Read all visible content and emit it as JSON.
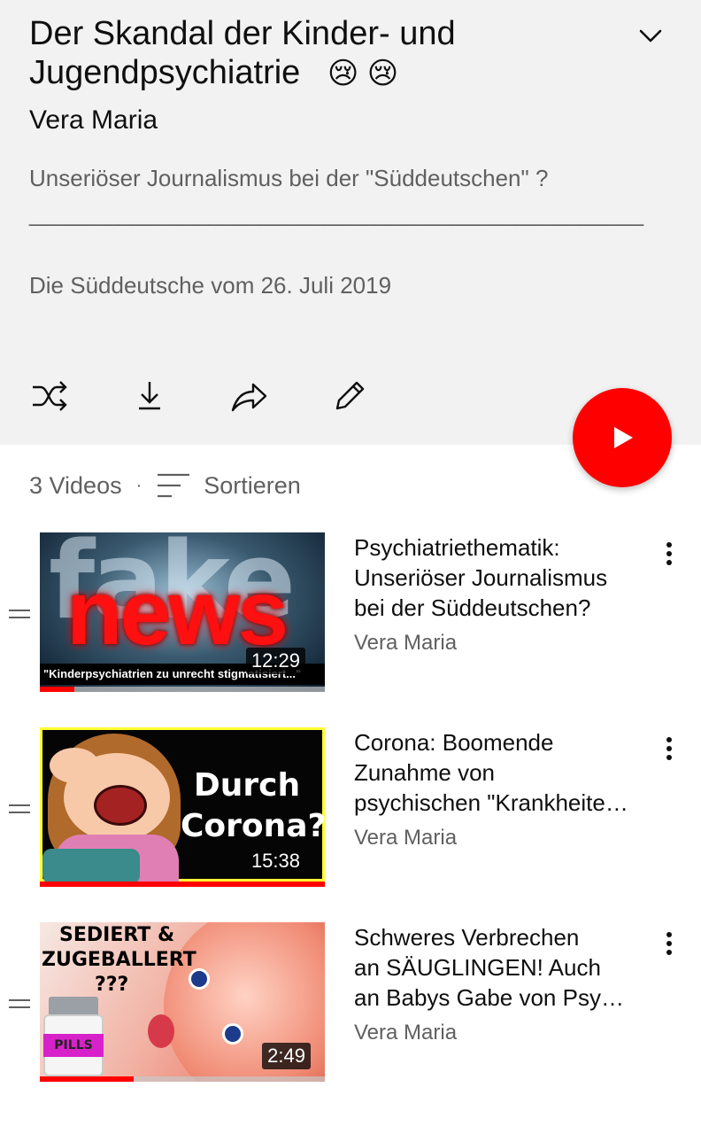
{
  "playlist": {
    "title_line1": "Der Skandal der Kinder- und",
    "title_line2": "Jugendpsychiatrie",
    "title_emoji": "😢 😢",
    "author": "Vera Maria",
    "description_line1": "Unseriöser Journalismus bei der \"Süddeutschen\" ?",
    "description_separator": "________________________________________________",
    "description_line2": "Die Süddeutsche vom 26. Juli 2019"
  },
  "actions": {
    "icons": [
      "shuffle-icon",
      "download-icon",
      "share-icon",
      "edit-icon"
    ],
    "play_icon": "play-icon",
    "accent_color": "#ff0000"
  },
  "list_meta": {
    "count": "3 Videos",
    "separator": "·",
    "sort_label": "Sortieren"
  },
  "videos": [
    {
      "title_lines": [
        "Psychiatriethematik:",
        "Unseriöser Journalismus",
        "bei der Süddeutschen?"
      ],
      "channel": "Vera Maria",
      "duration": "12:29",
      "watched_fraction": 0.12,
      "thumb_text": [
        "fake",
        "news",
        "\"Kinderpsychiatrien zu unrecht stigmatisiert...\""
      ]
    },
    {
      "title_lines": [
        "Corona: Boomende",
        "Zunahme von",
        "psychischen \"Krankheite…"
      ],
      "channel": "Vera Maria",
      "duration": "15:38",
      "watched_fraction": 1.0,
      "thumb_text": [
        "Durch",
        "Corona?"
      ]
    },
    {
      "title_lines": [
        "Schweres Verbrechen",
        "an SÄUGLINGEN! Auch",
        "an Babys Gabe von Psy…"
      ],
      "channel": "Vera Maria",
      "duration": "2:49",
      "watched_fraction": 0.33,
      "thumb_text": [
        "SEDIERT &",
        "ZUGEBALLERT",
        "???",
        "PILLS"
      ]
    }
  ]
}
